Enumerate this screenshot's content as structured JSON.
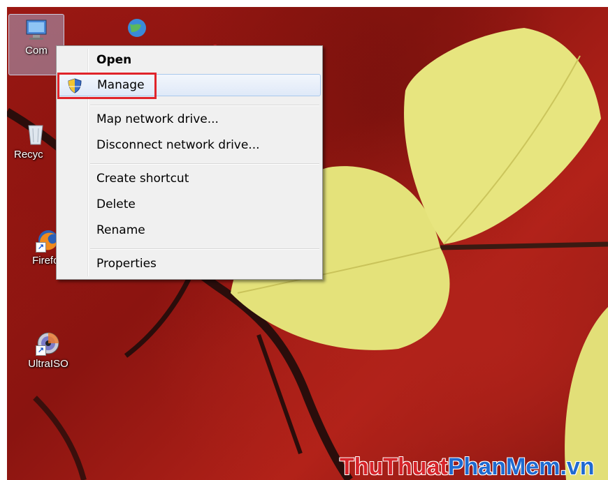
{
  "desktop": {
    "icons": [
      {
        "label": "Com",
        "icon": "computer-icon"
      },
      {
        "label": "",
        "icon": "network-globe-icon"
      },
      {
        "label": "Recyc",
        "icon": "recycle-bin-icon"
      },
      {
        "label": "Firefox",
        "icon": "firefox-icon"
      },
      {
        "label": "UltraISO",
        "icon": "ultraiso-disc-icon"
      }
    ]
  },
  "context_menu": {
    "items": [
      {
        "label": "Open",
        "bold": true
      },
      {
        "label": "Manage",
        "icon": "uac-shield-icon",
        "hovered": true
      },
      {
        "label": "Map network drive..."
      },
      {
        "label": "Disconnect network drive..."
      },
      {
        "label": "Create shortcut"
      },
      {
        "label": "Delete"
      },
      {
        "label": "Rename"
      },
      {
        "label": "Properties"
      }
    ]
  },
  "annotation": {
    "highlight_color": "#e0242b",
    "arrow_color": "#e0242b"
  },
  "watermark": {
    "part1": "ThuThuat",
    "part2": "PhanMem",
    "part3": ".vn"
  }
}
